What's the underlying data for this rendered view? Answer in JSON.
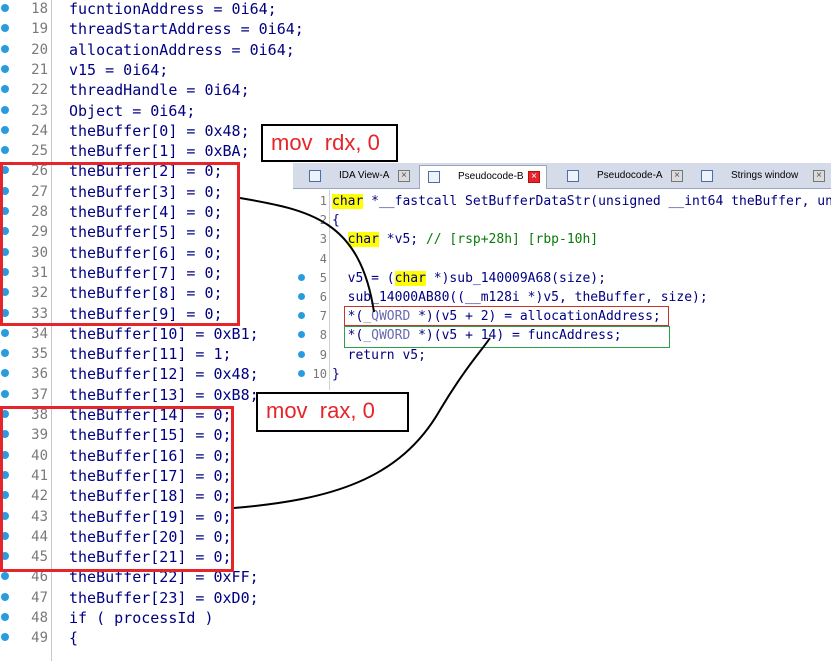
{
  "left_panel": {
    "lines": [
      {
        "no": "18",
        "code": "fucntionAddress = 0i64;"
      },
      {
        "no": "19",
        "code": "threadStartAddress = 0i64;"
      },
      {
        "no": "20",
        "code": "allocationAddress = 0i64;"
      },
      {
        "no": "21",
        "code": "v15 = 0i64;"
      },
      {
        "no": "22",
        "code": "threadHandle = 0i64;"
      },
      {
        "no": "23",
        "code": "Object = 0i64;"
      },
      {
        "no": "24",
        "code": "theBuffer[0] = 0x48;"
      },
      {
        "no": "25",
        "code": "theBuffer[1] = 0xBA;"
      },
      {
        "no": "26",
        "code": "theBuffer[2] = 0;"
      },
      {
        "no": "27",
        "code": "theBuffer[3] = 0;"
      },
      {
        "no": "28",
        "code": "theBuffer[4] = 0;"
      },
      {
        "no": "29",
        "code": "theBuffer[5] = 0;"
      },
      {
        "no": "30",
        "code": "theBuffer[6] = 0;"
      },
      {
        "no": "31",
        "code": "theBuffer[7] = 0;"
      },
      {
        "no": "32",
        "code": "theBuffer[8] = 0;"
      },
      {
        "no": "33",
        "code": "theBuffer[9] = 0;"
      },
      {
        "no": "34",
        "code": "theBuffer[10] = 0xB1;"
      },
      {
        "no": "35",
        "code": "theBuffer[11] = 1;"
      },
      {
        "no": "36",
        "code": "theBuffer[12] = 0x48;"
      },
      {
        "no": "37",
        "code": "theBuffer[13] = 0xB8;"
      },
      {
        "no": "38",
        "code": "theBuffer[14] = 0;"
      },
      {
        "no": "39",
        "code": "theBuffer[15] = 0;"
      },
      {
        "no": "40",
        "code": "theBuffer[16] = 0;"
      },
      {
        "no": "41",
        "code": "theBuffer[17] = 0;"
      },
      {
        "no": "42",
        "code": "theBuffer[18] = 0;"
      },
      {
        "no": "43",
        "code": "theBuffer[19] = 0;"
      },
      {
        "no": "44",
        "code": "theBuffer[20] = 0;"
      },
      {
        "no": "45",
        "code": "theBuffer[21] = 0;"
      },
      {
        "no": "46",
        "code": "theBuffer[22] = 0xFF;"
      },
      {
        "no": "47",
        "code": "theBuffer[23] = 0xD0;"
      },
      {
        "no": "48",
        "code": "if ( processId )"
      },
      {
        "no": "49",
        "code": "{"
      }
    ]
  },
  "annotations": {
    "rdx_label": "mov  rdx, 0",
    "rax_label": "mov  rax, 0"
  },
  "tabs": [
    {
      "label": "IDA View-A",
      "active": false
    },
    {
      "label": "Pseudocode-B",
      "active": true
    },
    {
      "label": "Pseudocode-A",
      "active": false
    },
    {
      "label": "Strings window",
      "active": false
    }
  ],
  "right_panel": {
    "lines": [
      {
        "no": "1",
        "segs": [
          [
            "kw",
            "char"
          ],
          [
            "n",
            " *__fastcall SetBufferDataStr(unsigned __int64 theBuffer, un"
          ]
        ]
      },
      {
        "no": "2",
        "segs": [
          [
            "n",
            "{"
          ]
        ]
      },
      {
        "no": "3",
        "segs": [
          [
            "n",
            "  "
          ],
          [
            "kw",
            "char"
          ],
          [
            "n",
            " *v5; "
          ],
          [
            "cm",
            "// [rsp+28h] [rbp-10h]"
          ]
        ]
      },
      {
        "no": "4",
        "segs": [
          [
            "n",
            ""
          ]
        ]
      },
      {
        "no": "5",
        "segs": [
          [
            "n",
            "  v5 = ("
          ],
          [
            "kw",
            "char"
          ],
          [
            "n",
            " *)sub_140009A68(size);"
          ]
        ]
      },
      {
        "no": "6",
        "segs": [
          [
            "n",
            "  sub_14000AB80((__m128i *)v5, theBuffer, size);"
          ]
        ]
      },
      {
        "no": "7",
        "segs": [
          [
            "n",
            "  *("
          ],
          [
            "typ",
            "_QWORD"
          ],
          [
            "n",
            " *)(v5 + 2) = allocationAddress;"
          ]
        ]
      },
      {
        "no": "8",
        "segs": [
          [
            "n",
            "  *("
          ],
          [
            "typ",
            "_QWORD"
          ],
          [
            "n",
            " *)(v5 + 14) = funcAddress;"
          ]
        ]
      },
      {
        "no": "9",
        "segs": [
          [
            "n",
            "  return v5;"
          ]
        ]
      },
      {
        "no": "10",
        "segs": [
          [
            "n",
            "}"
          ]
        ]
      }
    ]
  },
  "colors": {
    "annotation_red": "#e5252a",
    "keyword_highlight": "#ffff00",
    "breakpoint_blue": "#2b9be0",
    "highlight_green": "#2e9e4a"
  }
}
